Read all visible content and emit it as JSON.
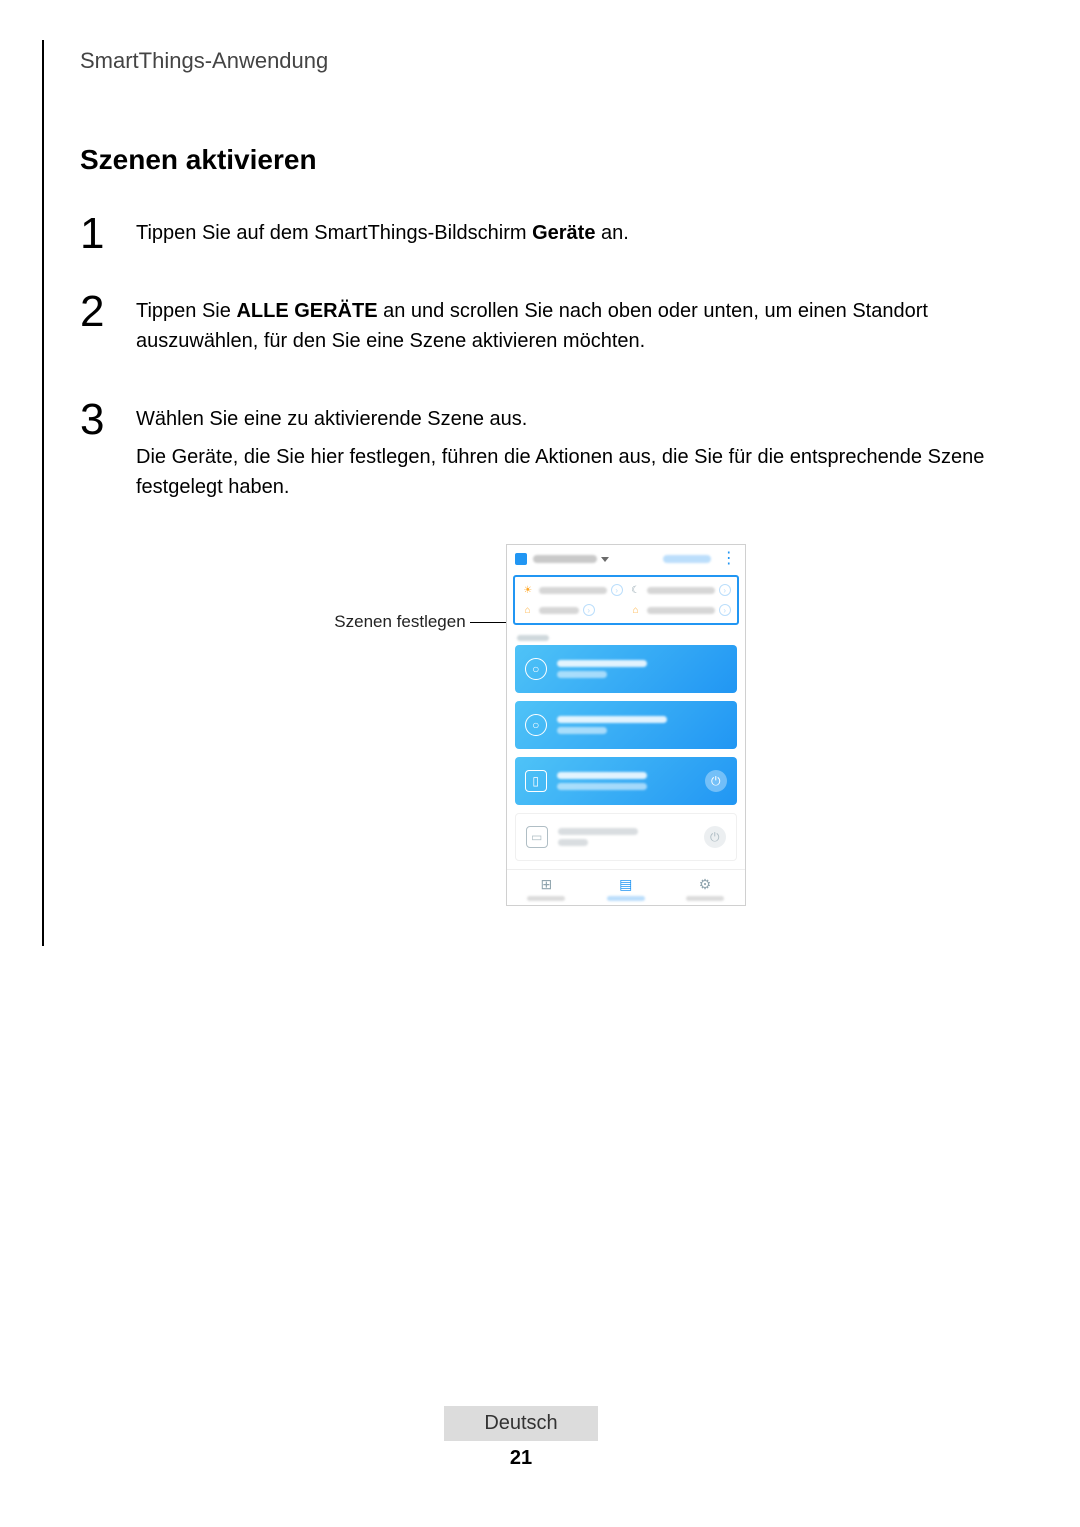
{
  "runningHead": "SmartThings-Anwendung",
  "heading": "Szenen aktivieren",
  "steps": {
    "s1": {
      "num": "1",
      "text_a": "Tippen Sie auf dem SmartThings-Bildschirm ",
      "bold": "Geräte",
      "text_b": " an."
    },
    "s2": {
      "num": "2",
      "text_a": "Tippen Sie ",
      "bold": "ALLE GERÄTE",
      "text_b": " an und scrollen Sie nach oben oder unten, um einen Standort auszuwählen, für den Sie eine Szene aktivieren möchten."
    },
    "s3": {
      "num": "3",
      "line1": "Wählen Sie eine zu aktivierende Szene aus.",
      "line2": "Die Geräte, die Sie hier festlegen, führen die Aktionen aus, die Sie für die entsprechende Szene festgelegt haben."
    }
  },
  "callout": "Szenen festlegen",
  "phone": {
    "topbar": {
      "dropdown": "ALL DEVICES",
      "right": "ADD DEVICE"
    },
    "scenes": [
      {
        "icon": "sun-icon",
        "glyph": "☀",
        "label": "Good morning"
      },
      {
        "icon": "moon-icon",
        "glyph": "☾",
        "label": "Good night"
      },
      {
        "icon": "home-out-icon",
        "glyph": "⌂",
        "label": "Going out"
      },
      {
        "icon": "home-in-icon",
        "glyph": "⌂",
        "label": "Coming home"
      }
    ],
    "sectionLabel": "HOME",
    "devices": [
      {
        "type": "blue",
        "icon": "hub-icon",
        "glyph": "○",
        "title": "Wi-Fi Hub",
        "sub": "Online",
        "power": false
      },
      {
        "type": "blue",
        "icon": "hub-icon",
        "glyph": "○",
        "title": "SmartThings HUB",
        "sub": "Connected",
        "power": false
      },
      {
        "type": "blue",
        "icon": "ac-icon",
        "glyph": "▯",
        "title": "Airconditioner",
        "sub": "Home 24°C Set 18°C",
        "power": true
      },
      {
        "type": "white",
        "icon": "tv-icon",
        "glyph": "▭",
        "title": "Samsung TV",
        "sub": "Off",
        "power": true
      }
    ],
    "tabs": [
      {
        "icon": "dashboard-icon",
        "glyph": "⊞",
        "label": "Dashboard",
        "active": false
      },
      {
        "icon": "devices-icon",
        "glyph": "▤",
        "label": "Devices",
        "active": true
      },
      {
        "icon": "automations-icon",
        "glyph": "⚙",
        "label": "Automations",
        "active": false
      }
    ]
  },
  "footer": {
    "language": "Deutsch",
    "page": "21"
  }
}
